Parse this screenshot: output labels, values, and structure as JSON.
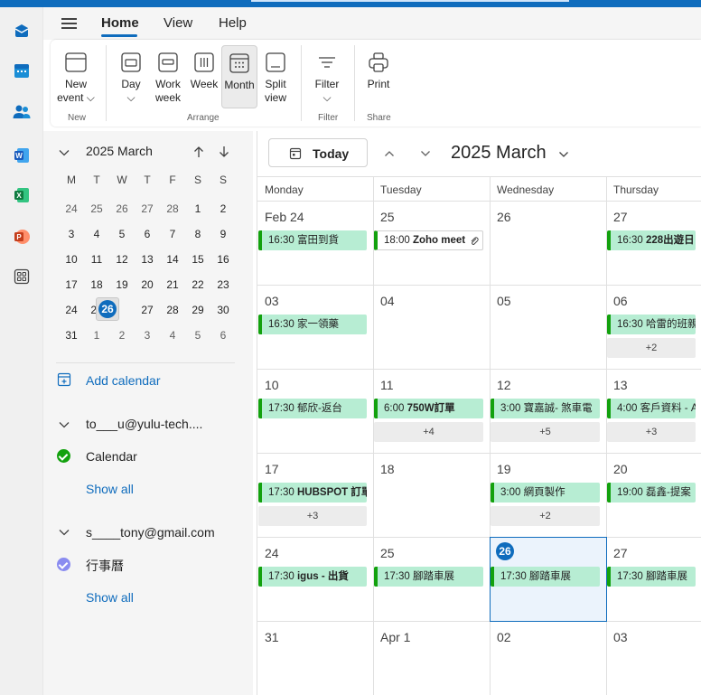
{
  "colors": {
    "accent": "#0f6cbd",
    "event_bg": "#b7edd3",
    "event_bar": "#13a10e",
    "pane_bg": "#f5f5f5"
  },
  "rail": {
    "icons": [
      "outlook-icon",
      "calendar-icon",
      "people-icon",
      "word-icon",
      "excel-icon",
      "powerpoint-icon",
      "more-apps-icon"
    ]
  },
  "tabs": [
    {
      "label": "Home"
    },
    {
      "label": "View"
    },
    {
      "label": "Help"
    }
  ],
  "ribbon": {
    "new_event": {
      "line1": "New",
      "line2": "event ⌵"
    },
    "day": {
      "line1": "Day",
      "line2": "⌵"
    },
    "work_week": {
      "line1": "Work",
      "line2": "week"
    },
    "week": {
      "line1": "Week"
    },
    "month": {
      "line1": "Month"
    },
    "split_view": {
      "line1": "Split",
      "line2": "view"
    },
    "filter": {
      "line1": "Filter",
      "line2": "⌵"
    },
    "print": {
      "line1": "Print"
    },
    "groups": {
      "new": "New",
      "arrange": "Arrange",
      "filter": "Filter",
      "share": "Share"
    }
  },
  "mini_calendar": {
    "title": "2025 March",
    "weekdays": [
      "M",
      "T",
      "W",
      "T",
      "F",
      "S",
      "S"
    ],
    "weeks": [
      [
        [
          "24",
          1
        ],
        [
          "25",
          1
        ],
        [
          "26",
          1
        ],
        [
          "27",
          1
        ],
        [
          "28",
          1
        ],
        [
          "1",
          0
        ],
        [
          "2",
          0
        ]
      ],
      [
        [
          "3",
          0
        ],
        [
          "4",
          0
        ],
        [
          "5",
          0
        ],
        [
          "6",
          0
        ],
        [
          "7",
          0
        ],
        [
          "8",
          0
        ],
        [
          "9",
          0
        ]
      ],
      [
        [
          "10",
          0
        ],
        [
          "11",
          0
        ],
        [
          "12",
          0
        ],
        [
          "13",
          0
        ],
        [
          "14",
          0
        ],
        [
          "15",
          0
        ],
        [
          "16",
          0
        ]
      ],
      [
        [
          "17",
          0
        ],
        [
          "18",
          0
        ],
        [
          "19",
          0
        ],
        [
          "20",
          0
        ],
        [
          "21",
          0
        ],
        [
          "22",
          0
        ],
        [
          "23",
          0
        ]
      ],
      [
        [
          "24",
          0
        ],
        [
          "25",
          0
        ],
        [
          "26",
          0
        ],
        [
          "27",
          0
        ],
        [
          "28",
          0
        ],
        [
          "29",
          0
        ],
        [
          "30",
          0
        ]
      ],
      [
        [
          "31",
          0
        ],
        [
          "1",
          1
        ],
        [
          "2",
          1
        ],
        [
          "3",
          1
        ],
        [
          "4",
          1
        ],
        [
          "5",
          1
        ],
        [
          "6",
          1
        ]
      ]
    ],
    "today": "26"
  },
  "nav": {
    "add_calendar": "Add calendar",
    "account1": "to___u@yulu-tech....",
    "account1_calendar": "Calendar",
    "show_all_1": "Show all",
    "account2": "s____tony@gmail.com",
    "account2_calendar": "行事曆",
    "show_all_2": "Show all"
  },
  "toolbar": {
    "today_label": "Today",
    "month_title": "2025 March"
  },
  "weekday_headers": [
    "Monday",
    "Tuesday",
    "Wednesday",
    "Thursday"
  ],
  "weeks": [
    {
      "days": [
        "Feb 24",
        "25",
        "26",
        "27"
      ],
      "events": [
        {
          "col": 0,
          "time": "16:30",
          "title": "富田到貨",
          "bold": false
        },
        {
          "col": 1,
          "time": "18:00",
          "title": "Zoho meet",
          "bold": true,
          "plain": true,
          "attachment": true
        },
        {
          "col": 3,
          "time": "16:30",
          "title": "228出遊日",
          "bold": true
        }
      ],
      "more": []
    },
    {
      "days": [
        "03",
        "04",
        "05",
        "06"
      ],
      "events": [
        {
          "col": 0,
          "time": "16:30",
          "title": "家一領藥",
          "bold": false
        },
        {
          "col": 3,
          "time": "16:30",
          "title": "哈雷的班親",
          "bold": false
        }
      ],
      "more": [
        {
          "col": 3,
          "label": "+2"
        }
      ]
    },
    {
      "days": [
        "10",
        "11",
        "12",
        "13"
      ],
      "events": [
        {
          "col": 0,
          "time": "17:30",
          "title": "郁欣-返台",
          "bold": false
        },
        {
          "col": 1,
          "time": "6:00",
          "title": "750W訂單",
          "bold": true
        },
        {
          "col": 2,
          "time": "3:00",
          "title": "寶嘉誠- 煞車電",
          "bold": false
        },
        {
          "col": 3,
          "time": "4:00",
          "title": "客戶資料 - A",
          "bold": false
        }
      ],
      "more": [
        {
          "col": 1,
          "label": "+4"
        },
        {
          "col": 2,
          "label": "+5"
        },
        {
          "col": 3,
          "label": "+3"
        }
      ]
    },
    {
      "days": [
        "17",
        "18",
        "19",
        "20"
      ],
      "events": [
        {
          "col": 0,
          "time": "17:30",
          "title": "HUBSPOT 訂單",
          "bold": true
        },
        {
          "col": 2,
          "time": "3:00",
          "title": "網頁製作",
          "bold": false
        },
        {
          "col": 3,
          "time": "19:00",
          "title": "磊鑫-提案",
          "bold": false
        }
      ],
      "more": [
        {
          "col": 0,
          "label": "+3"
        },
        {
          "col": 2,
          "label": "+2"
        }
      ]
    },
    {
      "days": [
        "24",
        "25",
        "26",
        "27"
      ],
      "events": [
        {
          "col": 0,
          "time": "17:30",
          "title": "igus - 出貨",
          "bold": true
        },
        {
          "col": 1,
          "time": "17:30",
          "title": "腳踏車展",
          "bold": false
        },
        {
          "col": 2,
          "time": "17:30",
          "title": "腳踏車展",
          "bold": false
        },
        {
          "col": 3,
          "time": "17:30",
          "title": "腳踏車展",
          "bold": false
        }
      ],
      "more": []
    },
    {
      "days": [
        "31",
        "Apr 1",
        "02",
        "03"
      ],
      "events": [],
      "more": []
    }
  ]
}
